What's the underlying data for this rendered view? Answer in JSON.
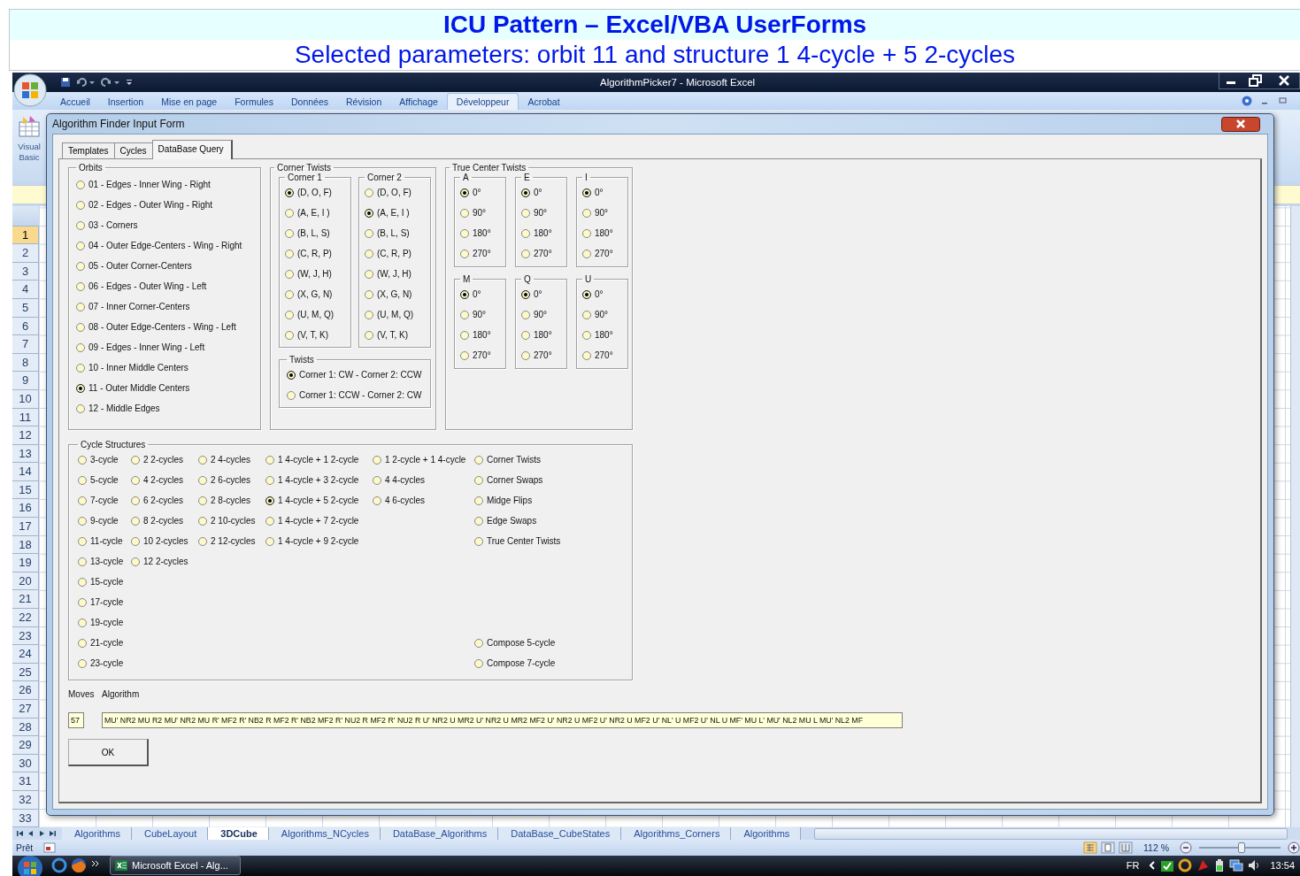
{
  "banner": {
    "title": "ICU Pattern – Excel/VBA UserForms",
    "subtitle": "Selected parameters: orbit 11 and structure 1 4-cycle + 5 2-cycles"
  },
  "excel": {
    "title": "AlgorithmPicker7 - Microsoft Excel",
    "ribbon_tabs": [
      {
        "label": "Accueil",
        "selected": false
      },
      {
        "label": "Insertion",
        "selected": false
      },
      {
        "label": "Mise en page",
        "selected": false
      },
      {
        "label": "Formules",
        "selected": false
      },
      {
        "label": "Données",
        "selected": false
      },
      {
        "label": "Révision",
        "selected": false
      },
      {
        "label": "Affichage",
        "selected": false
      },
      {
        "label": "Développeur",
        "selected": true
      },
      {
        "label": "Acrobat",
        "selected": false
      }
    ],
    "ribbon_button": "Visual Basic",
    "row_headers": [
      {
        "label": "1",
        "selected": true
      },
      {
        "label": "2",
        "selected": false
      },
      {
        "label": "3",
        "selected": false
      },
      {
        "label": "4",
        "selected": false
      },
      {
        "label": "5",
        "selected": false
      },
      {
        "label": "6",
        "selected": false
      },
      {
        "label": "7",
        "selected": false
      },
      {
        "label": "8",
        "selected": false
      },
      {
        "label": "9",
        "selected": false
      },
      {
        "label": "10",
        "selected": false
      },
      {
        "label": "11",
        "selected": false
      },
      {
        "label": "12",
        "selected": false
      },
      {
        "label": "13",
        "selected": false
      },
      {
        "label": "14",
        "selected": false
      },
      {
        "label": "15",
        "selected": false
      },
      {
        "label": "16",
        "selected": false
      },
      {
        "label": "17",
        "selected": false
      },
      {
        "label": "18",
        "selected": false
      },
      {
        "label": "19",
        "selected": false
      },
      {
        "label": "20",
        "selected": false
      },
      {
        "label": "21",
        "selected": false
      },
      {
        "label": "22",
        "selected": false
      },
      {
        "label": "23",
        "selected": false
      },
      {
        "label": "24",
        "selected": false
      },
      {
        "label": "25",
        "selected": false
      },
      {
        "label": "26",
        "selected": false
      },
      {
        "label": "27",
        "selected": false
      },
      {
        "label": "28",
        "selected": false
      },
      {
        "label": "29",
        "selected": false
      },
      {
        "label": "30",
        "selected": false
      },
      {
        "label": "31",
        "selected": false
      },
      {
        "label": "32",
        "selected": false
      },
      {
        "label": "33",
        "selected": false
      }
    ],
    "sheet_tabs": [
      {
        "label": "Algorithms",
        "selected": false
      },
      {
        "label": "CubeLayout",
        "selected": false
      },
      {
        "label": "3DCube",
        "selected": true
      },
      {
        "label": "Algorithms_NCycles",
        "selected": false
      },
      {
        "label": "DataBase_Algorithms",
        "selected": false
      },
      {
        "label": "DataBase_CubeStates",
        "selected": false
      },
      {
        "label": "Algorithms_Corners",
        "selected": false
      },
      {
        "label": "Algorithms",
        "selected": false
      }
    ],
    "status_bar": {
      "status": "Prêt",
      "zoom": "112 %",
      "zoom_slider": {
        "level": 0.52
      }
    },
    "taskbar": {
      "task": "Microsoft Excel - Alg...",
      "language": "FR",
      "time": "13:54"
    }
  },
  "form": {
    "title": "Algorithm Finder Input Form",
    "tabs": [
      {
        "label": "Templates",
        "selected": false
      },
      {
        "label": "Cycles",
        "selected": false
      },
      {
        "label": "DataBase Query",
        "selected": true
      }
    ],
    "orbits": {
      "label": "Orbits",
      "options": [
        {
          "label": "01 - Edges - Inner Wing - Right",
          "selected": false
        },
        {
          "label": "02 - Edges - Outer Wing - Right",
          "selected": false
        },
        {
          "label": "03 - Corners",
          "selected": false
        },
        {
          "label": "04 - Outer Edge-Centers - Wing - Right",
          "selected": false
        },
        {
          "label": "05 - Outer Corner-Centers",
          "selected": false
        },
        {
          "label": "06 - Edges - Outer Wing - Left",
          "selected": false
        },
        {
          "label": "07 - Inner Corner-Centers",
          "selected": false
        },
        {
          "label": "08 - Outer Edge-Centers - Wing - Left",
          "selected": false
        },
        {
          "label": "09 - Edges - Inner Wing - Left",
          "selected": false
        },
        {
          "label": "10 - Inner Middle Centers",
          "selected": false
        },
        {
          "label": "11 - Outer Middle Centers",
          "selected": true
        },
        {
          "label": "12 - Middle Edges",
          "selected": false
        }
      ]
    },
    "corner_twists": {
      "label": "Corner Twists",
      "corners": [
        {
          "label": "Corner 1",
          "options": [
            {
              "label": "(D, O, F)",
              "selected": true
            },
            {
              "label": "(A, E, I )",
              "selected": false
            },
            {
              "label": "(B, L, S)",
              "selected": false
            },
            {
              "label": "(C, R, P)",
              "selected": false
            },
            {
              "label": "(W, J, H)",
              "selected": false
            },
            {
              "label": "(X, G, N)",
              "selected": false
            },
            {
              "label": "(U, M, Q)",
              "selected": false
            },
            {
              "label": "(V, T, K)",
              "selected": false
            }
          ]
        },
        {
          "label": "Corner 2",
          "options": [
            {
              "label": "(D, O, F)",
              "selected": false
            },
            {
              "label": "(A, E, I )",
              "selected": true
            },
            {
              "label": "(B, L, S)",
              "selected": false
            },
            {
              "label": "(C, R, P)",
              "selected": false
            },
            {
              "label": "(W, J, H)",
              "selected": false
            },
            {
              "label": "(X, G, N)",
              "selected": false
            },
            {
              "label": "(U, M, Q)",
              "selected": false
            },
            {
              "label": "(V, T, K)",
              "selected": false
            }
          ]
        }
      ],
      "twists": {
        "label": "Twists",
        "options": [
          {
            "label": "Corner 1: CW - Corner 2: CCW",
            "selected": true
          },
          {
            "label": "Corner 1: CCW - Corner 2: CW",
            "selected": false
          }
        ]
      }
    },
    "true_center_twists": {
      "label": "True Center Twists",
      "centers": [
        {
          "label": "A",
          "options": [
            {
              "label": "0°",
              "selected": true
            },
            {
              "label": "90°",
              "selected": false
            },
            {
              "label": "180°",
              "selected": false
            },
            {
              "label": "270°",
              "selected": false
            }
          ]
        },
        {
          "label": "E",
          "options": [
            {
              "label": "0°",
              "selected": true
            },
            {
              "label": "90°",
              "selected": false
            },
            {
              "label": "180°",
              "selected": false
            },
            {
              "label": "270°",
              "selected": false
            }
          ]
        },
        {
          "label": "I",
          "options": [
            {
              "label": "0°",
              "selected": true
            },
            {
              "label": "90°",
              "selected": false
            },
            {
              "label": "180°",
              "selected": false
            },
            {
              "label": "270°",
              "selected": false
            }
          ]
        },
        {
          "label": "M",
          "options": [
            {
              "label": "0°",
              "selected": true
            },
            {
              "label": "90°",
              "selected": false
            },
            {
              "label": "180°",
              "selected": false
            },
            {
              "label": "270°",
              "selected": false
            }
          ]
        },
        {
          "label": "Q",
          "options": [
            {
              "label": "0°",
              "selected": true
            },
            {
              "label": "90°",
              "selected": false
            },
            {
              "label": "180°",
              "selected": false
            },
            {
              "label": "270°",
              "selected": false
            }
          ]
        },
        {
          "label": "U",
          "options": [
            {
              "label": "0°",
              "selected": true
            },
            {
              "label": "90°",
              "selected": false
            },
            {
              "label": "180°",
              "selected": false
            },
            {
              "label": "270°",
              "selected": false
            }
          ]
        }
      ]
    },
    "cycle_structures": {
      "label": "Cycle Structures",
      "columns": [
        {
          "options": [
            {
              "label": "3-cycle",
              "selected": false
            },
            {
              "label": "5-cycle",
              "selected": false
            },
            {
              "label": "7-cycle",
              "selected": false
            },
            {
              "label": "9-cycle",
              "selected": false
            },
            {
              "label": "11-cycle",
              "selected": false
            },
            {
              "label": "13-cycle",
              "selected": false
            },
            {
              "label": "15-cycle",
              "selected": false
            },
            {
              "label": "17-cycle",
              "selected": false
            },
            {
              "label": "19-cycle",
              "selected": false
            },
            {
              "label": "21-cycle",
              "selected": false
            },
            {
              "label": "23-cycle",
              "selected": false
            }
          ]
        },
        {
          "options": [
            {
              "label": "2 2-cycles",
              "selected": false
            },
            {
              "label": "4 2-cycles",
              "selected": false
            },
            {
              "label": "6 2-cycles",
              "selected": false
            },
            {
              "label": "8 2-cycles",
              "selected": false
            },
            {
              "label": "10 2-cycles",
              "selected": false
            },
            {
              "label": "12 2-cycles",
              "selected": false
            }
          ]
        },
        {
          "options": [
            {
              "label": "2 4-cycles",
              "selected": false
            },
            {
              "label": "2 6-cycles",
              "selected": false
            },
            {
              "label": "2 8-cycles",
              "selected": false
            },
            {
              "label": "2 10-cycles",
              "selected": false
            },
            {
              "label": "2 12-cycles",
              "selected": false
            }
          ]
        },
        {
          "options": [
            {
              "label": "1 4-cycle + 1 2-cycle",
              "selected": false
            },
            {
              "label": "1 4-cycle + 3 2-cycle",
              "selected": false
            },
            {
              "label": "1 4-cycle + 5 2-cycle",
              "selected": true
            },
            {
              "label": "1 4-cycle + 7 2-cycle",
              "selected": false
            },
            {
              "label": "1 4-cycle + 9 2-cycle",
              "selected": false
            }
          ]
        },
        {
          "options": [
            {
              "label": "1 2-cycle + 1 4-cycle",
              "selected": false
            },
            {
              "label": "4 4-cycles",
              "selected": false
            },
            {
              "label": "4 6-cycles",
              "selected": false
            }
          ]
        },
        {
          "options": [
            {
              "label": "Corner Twists",
              "selected": false
            },
            {
              "label": "Corner Swaps",
              "selected": false
            },
            {
              "label": "Midge Flips",
              "selected": false
            },
            {
              "label": "Edge Swaps",
              "selected": false
            },
            {
              "label": "True Center Twists",
              "selected": false
            }
          ],
          "compose_options": [
            {
              "label": "Compose 5-cycle",
              "selected": false
            },
            {
              "label": "Compose 7-cycle",
              "selected": false
            }
          ]
        }
      ]
    },
    "moves": {
      "label": "Moves",
      "value": "57"
    },
    "algorithm": {
      "label": "Algorithm",
      "value": "MU' NR2 MU R2 MU' NR2 MU R' MF2 R' NB2 R MF2 R' NB2 MF2 R' NU2 R MF2 R' NU2 R U' NR2 U MR2 U' NR2 U MR2 MF2 U' NR2 U MF2 U' NR2 U MF2 U' NL' U MF2 U' NL U MF' MU L' MU' NL2 MU L MU' NL2 MF"
    },
    "ok_button": "OK"
  }
}
